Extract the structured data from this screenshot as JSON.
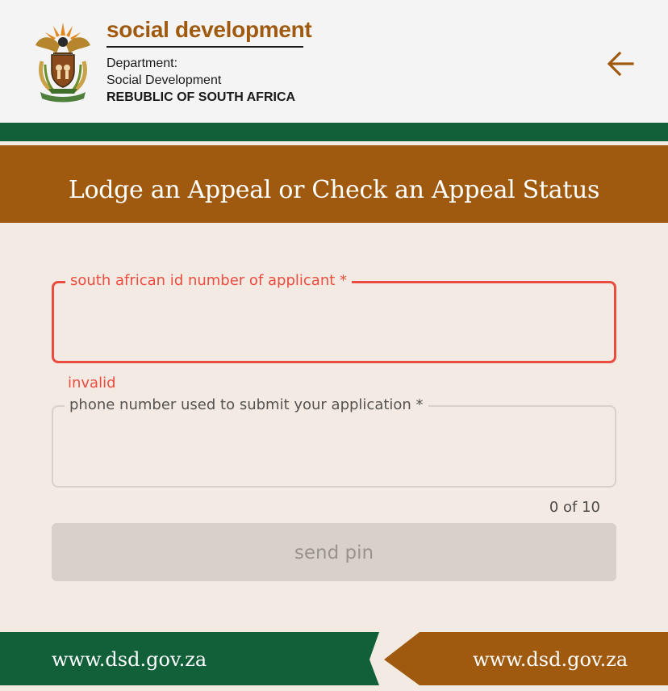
{
  "header": {
    "brand_title": "social development",
    "department_line1": "Department:",
    "department_line2": "Social Development",
    "country": "REBUBLIC OF SOUTH AFRICA",
    "crest_icon": "coat-of-arms-icon",
    "back_icon": "arrow-left-icon"
  },
  "banner": {
    "title": "Lodge an Appeal or Check an Appeal Status"
  },
  "form": {
    "id_field": {
      "label": "south african id number of applicant *",
      "value": "",
      "error": "invalid"
    },
    "phone_field": {
      "label": "phone number used to submit your application *",
      "value": "",
      "counter": "0 of 10"
    },
    "send_button": "send pin"
  },
  "footer": {
    "left_url": "www.dsd.gov.za",
    "right_url": "www.dsd.gov.za"
  },
  "colors": {
    "brand_brown": "#a05a0f",
    "brand_green": "#11603a",
    "error_red": "#ea4c3f",
    "background": "#f3ebe3"
  }
}
